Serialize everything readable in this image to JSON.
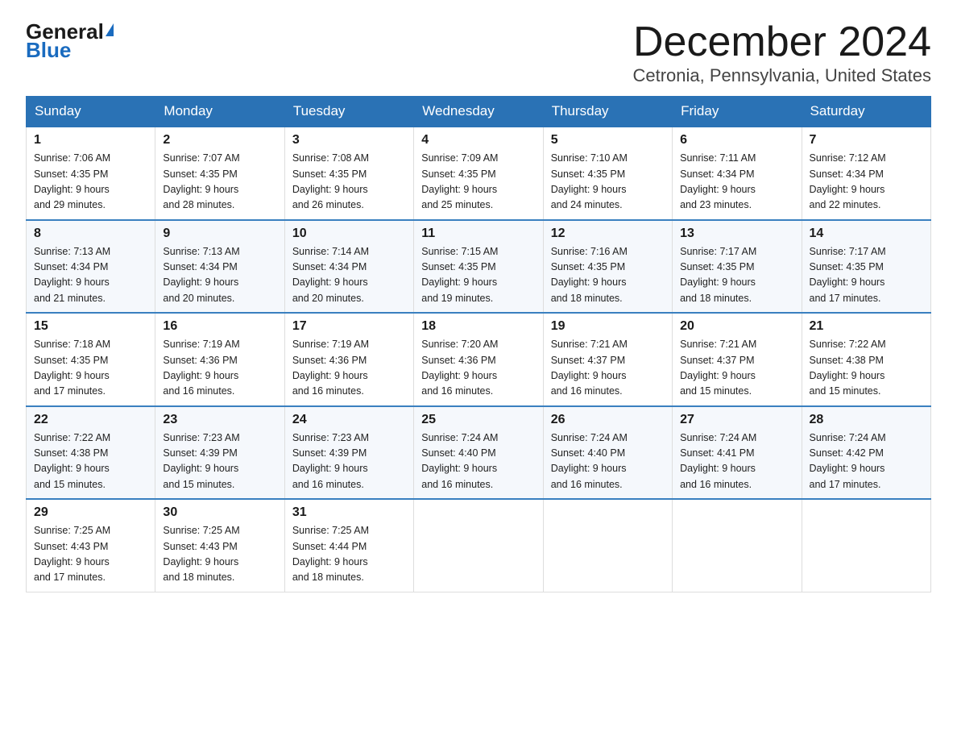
{
  "logo": {
    "general_text": "General",
    "blue_text": "Blue"
  },
  "header": {
    "month_year": "December 2024",
    "location": "Cetronia, Pennsylvania, United States"
  },
  "days_of_week": [
    "Sunday",
    "Monday",
    "Tuesday",
    "Wednesday",
    "Thursday",
    "Friday",
    "Saturday"
  ],
  "weeks": [
    [
      {
        "day": "1",
        "sunrise": "7:06 AM",
        "sunset": "4:35 PM",
        "daylight": "9 hours and 29 minutes."
      },
      {
        "day": "2",
        "sunrise": "7:07 AM",
        "sunset": "4:35 PM",
        "daylight": "9 hours and 28 minutes."
      },
      {
        "day": "3",
        "sunrise": "7:08 AM",
        "sunset": "4:35 PM",
        "daylight": "9 hours and 26 minutes."
      },
      {
        "day": "4",
        "sunrise": "7:09 AM",
        "sunset": "4:35 PM",
        "daylight": "9 hours and 25 minutes."
      },
      {
        "day": "5",
        "sunrise": "7:10 AM",
        "sunset": "4:35 PM",
        "daylight": "9 hours and 24 minutes."
      },
      {
        "day": "6",
        "sunrise": "7:11 AM",
        "sunset": "4:34 PM",
        "daylight": "9 hours and 23 minutes."
      },
      {
        "day": "7",
        "sunrise": "7:12 AM",
        "sunset": "4:34 PM",
        "daylight": "9 hours and 22 minutes."
      }
    ],
    [
      {
        "day": "8",
        "sunrise": "7:13 AM",
        "sunset": "4:34 PM",
        "daylight": "9 hours and 21 minutes."
      },
      {
        "day": "9",
        "sunrise": "7:13 AM",
        "sunset": "4:34 PM",
        "daylight": "9 hours and 20 minutes."
      },
      {
        "day": "10",
        "sunrise": "7:14 AM",
        "sunset": "4:34 PM",
        "daylight": "9 hours and 20 minutes."
      },
      {
        "day": "11",
        "sunrise": "7:15 AM",
        "sunset": "4:35 PM",
        "daylight": "9 hours and 19 minutes."
      },
      {
        "day": "12",
        "sunrise": "7:16 AM",
        "sunset": "4:35 PM",
        "daylight": "9 hours and 18 minutes."
      },
      {
        "day": "13",
        "sunrise": "7:17 AM",
        "sunset": "4:35 PM",
        "daylight": "9 hours and 18 minutes."
      },
      {
        "day": "14",
        "sunrise": "7:17 AM",
        "sunset": "4:35 PM",
        "daylight": "9 hours and 17 minutes."
      }
    ],
    [
      {
        "day": "15",
        "sunrise": "7:18 AM",
        "sunset": "4:35 PM",
        "daylight": "9 hours and 17 minutes."
      },
      {
        "day": "16",
        "sunrise": "7:19 AM",
        "sunset": "4:36 PM",
        "daylight": "9 hours and 16 minutes."
      },
      {
        "day": "17",
        "sunrise": "7:19 AM",
        "sunset": "4:36 PM",
        "daylight": "9 hours and 16 minutes."
      },
      {
        "day": "18",
        "sunrise": "7:20 AM",
        "sunset": "4:36 PM",
        "daylight": "9 hours and 16 minutes."
      },
      {
        "day": "19",
        "sunrise": "7:21 AM",
        "sunset": "4:37 PM",
        "daylight": "9 hours and 16 minutes."
      },
      {
        "day": "20",
        "sunrise": "7:21 AM",
        "sunset": "4:37 PM",
        "daylight": "9 hours and 15 minutes."
      },
      {
        "day": "21",
        "sunrise": "7:22 AM",
        "sunset": "4:38 PM",
        "daylight": "9 hours and 15 minutes."
      }
    ],
    [
      {
        "day": "22",
        "sunrise": "7:22 AM",
        "sunset": "4:38 PM",
        "daylight": "9 hours and 15 minutes."
      },
      {
        "day": "23",
        "sunrise": "7:23 AM",
        "sunset": "4:39 PM",
        "daylight": "9 hours and 15 minutes."
      },
      {
        "day": "24",
        "sunrise": "7:23 AM",
        "sunset": "4:39 PM",
        "daylight": "9 hours and 16 minutes."
      },
      {
        "day": "25",
        "sunrise": "7:24 AM",
        "sunset": "4:40 PM",
        "daylight": "9 hours and 16 minutes."
      },
      {
        "day": "26",
        "sunrise": "7:24 AM",
        "sunset": "4:40 PM",
        "daylight": "9 hours and 16 minutes."
      },
      {
        "day": "27",
        "sunrise": "7:24 AM",
        "sunset": "4:41 PM",
        "daylight": "9 hours and 16 minutes."
      },
      {
        "day": "28",
        "sunrise": "7:24 AM",
        "sunset": "4:42 PM",
        "daylight": "9 hours and 17 minutes."
      }
    ],
    [
      {
        "day": "29",
        "sunrise": "7:25 AM",
        "sunset": "4:43 PM",
        "daylight": "9 hours and 17 minutes."
      },
      {
        "day": "30",
        "sunrise": "7:25 AM",
        "sunset": "4:43 PM",
        "daylight": "9 hours and 18 minutes."
      },
      {
        "day": "31",
        "sunrise": "7:25 AM",
        "sunset": "4:44 PM",
        "daylight": "9 hours and 18 minutes."
      },
      null,
      null,
      null,
      null
    ]
  ],
  "labels": {
    "sunrise": "Sunrise:",
    "sunset": "Sunset:",
    "daylight": "Daylight:"
  }
}
